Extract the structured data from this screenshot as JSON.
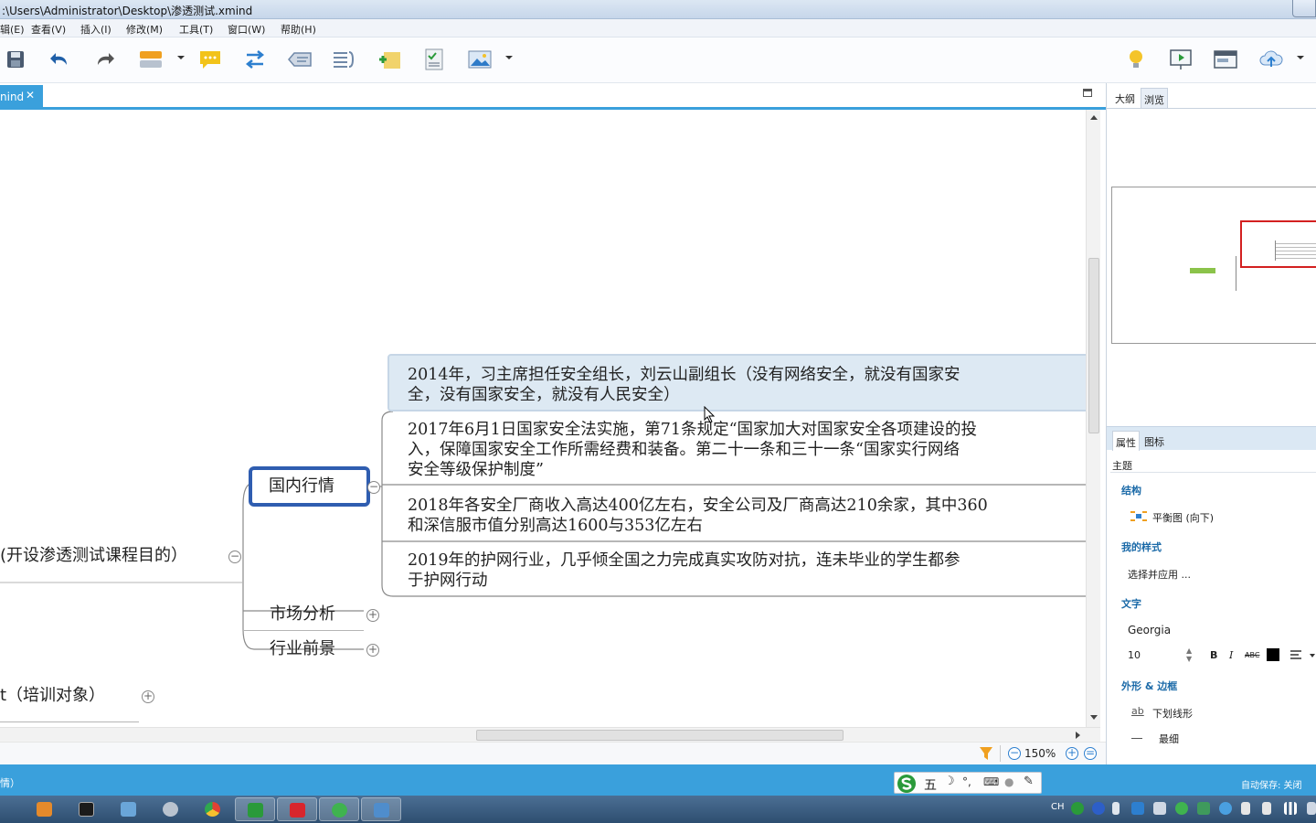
{
  "window": {
    "title": ":\\Users\\Administrator\\Desktop\\渗透测试.xmind"
  },
  "menu": [
    "辑(E)",
    "查看(V)",
    "插入(I)",
    "修改(M)",
    "工具(T)",
    "窗口(W)",
    "帮助(H)"
  ],
  "editor_tab": {
    "name": "nind",
    "close": "✕"
  },
  "mindmap": {
    "root_partial": "(开设渗透测试课程目的）",
    "branch_domestic": "国内行情",
    "branch_market": "市场分析",
    "branch_industry": "行业前景",
    "sibling_partial": "t（培训对象）",
    "details": [
      {
        "line1": "2014年，习主席担任安全组长，刘云山副组长（没有网络安全，就没有国家安",
        "line2": "全，没有国家安全，就没有人民安全）"
      },
      {
        "line1": "2017年6月1日国家安全法实施，第71条规定“国家加大对国家安全各项建设的投",
        "line2": "入，保障国家安全工作所需经费和装备。第二十一条和三十一条“国家实行网络",
        "line3": "安全等级保护制度”"
      },
      {
        "line1": "2018年各安全厂商收入高达400亿左右，安全公司及厂商高达210余家，其中360",
        "line2": "和深信服市值分别高达1600与353亿左右"
      },
      {
        "line1": "2019年的护网行业，几乎倾全国之力完成真实攻防对抗，连未毕业的学生都参",
        "line2": "于护网行动"
      }
    ]
  },
  "zoom": "150%",
  "right_panel": {
    "tabs": [
      "大纲",
      "浏览"
    ],
    "prop_tabs": [
      "属性",
      "图标"
    ],
    "section_topic": "主题",
    "structure_label": "结构",
    "structure_value": "平衡图 (向下)",
    "style_label": "我的样式",
    "style_value": "选择并应用 ...",
    "text_label": "文字",
    "font_name": "Georgia",
    "font_size": "10",
    "bold": "B",
    "italic": "I",
    "strike": "ABC",
    "shape_label": "外形 & 边框",
    "underline_icon_text": "ab",
    "underline_value": "下划线形",
    "line_value": "最细"
  },
  "status": {
    "left": "情）",
    "autosave": "自动保存: 关闭"
  },
  "ime": {
    "mode": "五"
  },
  "tray": {
    "lang": "CH"
  }
}
